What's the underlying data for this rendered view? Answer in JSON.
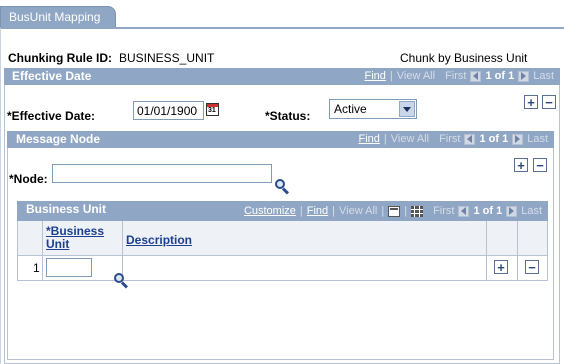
{
  "tab": {
    "label": "BusUnit Mapping"
  },
  "chunking": {
    "label": "Chunking Rule ID:",
    "value": "BUSINESS_UNIT",
    "description": "Chunk by Business Unit"
  },
  "effective_date_section": {
    "title": "Effective Date",
    "nav": {
      "find": "Find",
      "view_all": "View All",
      "first": "First",
      "range": "1 of 1",
      "last": "Last"
    },
    "date_label": "*Effective Date:",
    "date_value": "01/01/1900",
    "status_label": "*Status:",
    "status_value": "Active"
  },
  "message_node_section": {
    "title": "Message Node",
    "nav": {
      "find": "Find",
      "view_all": "View All",
      "first": "First",
      "range": "1 of 1",
      "last": "Last"
    },
    "node_label": "*Node:",
    "node_value": ""
  },
  "business_unit_grid": {
    "title": "Business Unit",
    "nav": {
      "customize": "Customize",
      "find": "Find",
      "view_all": "View All",
      "first": "First",
      "range": "1 of 1",
      "last": "Last"
    },
    "columns": {
      "business_unit_line1": "*Business",
      "business_unit_line2": "Unit",
      "description": "Description"
    },
    "rows": [
      {
        "num": "1",
        "business_unit": "",
        "description": ""
      }
    ]
  }
}
